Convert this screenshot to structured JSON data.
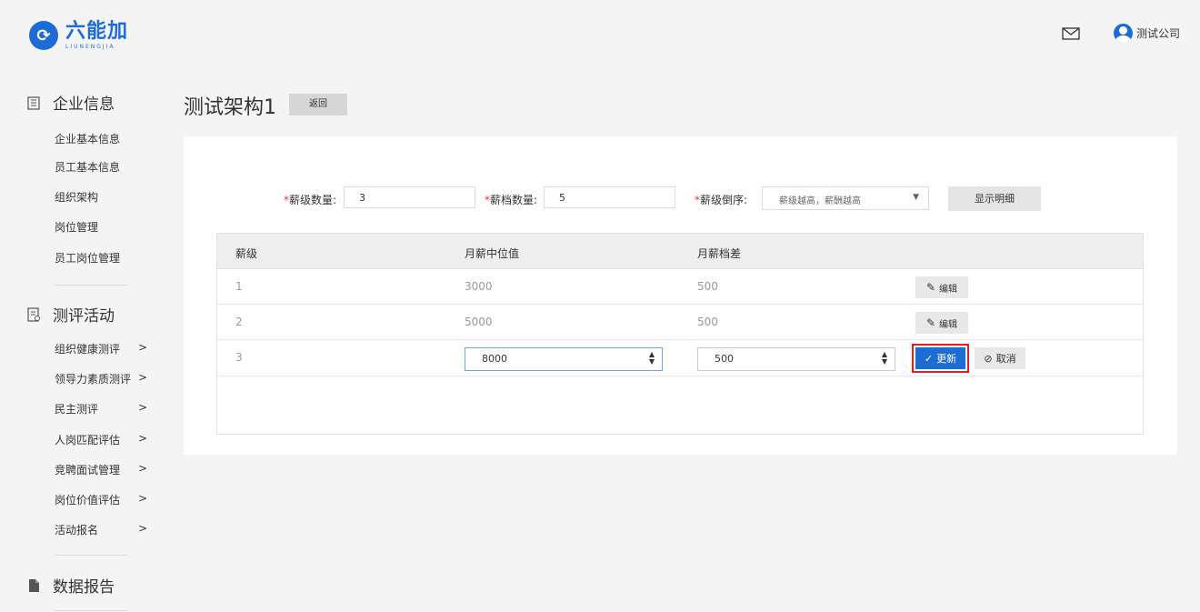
{
  "header": {
    "logo_cn": "六能加",
    "logo_en": "LIUNENGJIA",
    "user_name": "测试公司"
  },
  "sidebar": {
    "sections": [
      {
        "title": "企业信息",
        "icon": "building-icon",
        "items": [
          "企业基本信息",
          "员工基本信息",
          "组织架构",
          "岗位管理",
          "员工岗位管理"
        ]
      },
      {
        "title": "测评活动",
        "icon": "clipboard-icon",
        "items": [
          "组织健康测评",
          "领导力素质测评",
          "民主测评",
          "人岗匹配评估",
          "竞聘面试管理",
          "岗位价值评估",
          "活动报名"
        ]
      },
      {
        "title": "数据报告",
        "icon": "document-icon",
        "items": []
      }
    ],
    "chevron": ">"
  },
  "main": {
    "title": "测试架构1",
    "back_label": "返回",
    "form": {
      "req_mark": "*",
      "level_count_label": "薪级数量:",
      "level_count_value": "3",
      "band_count_label": "薪档数量:",
      "band_count_value": "5",
      "order_label": "薪级倒序:",
      "order_value": "薪级越高，薪酬越高",
      "detail_button": "显示明细"
    },
    "table": {
      "headers": [
        "薪级",
        "月薪中位值",
        "月薪档差"
      ],
      "rows": [
        {
          "level": "1",
          "median": "3000",
          "diff": "500",
          "action": "编辑"
        },
        {
          "level": "2",
          "median": "5000",
          "diff": "500",
          "action": "编辑"
        }
      ],
      "editing_row": {
        "level": "3",
        "median": "8000",
        "diff": "500",
        "update_label": "更新",
        "cancel_label": "取消"
      }
    }
  },
  "colors": {
    "accent": "#1d6bd4",
    "highlight": "#e02020",
    "required": "#e53935"
  }
}
